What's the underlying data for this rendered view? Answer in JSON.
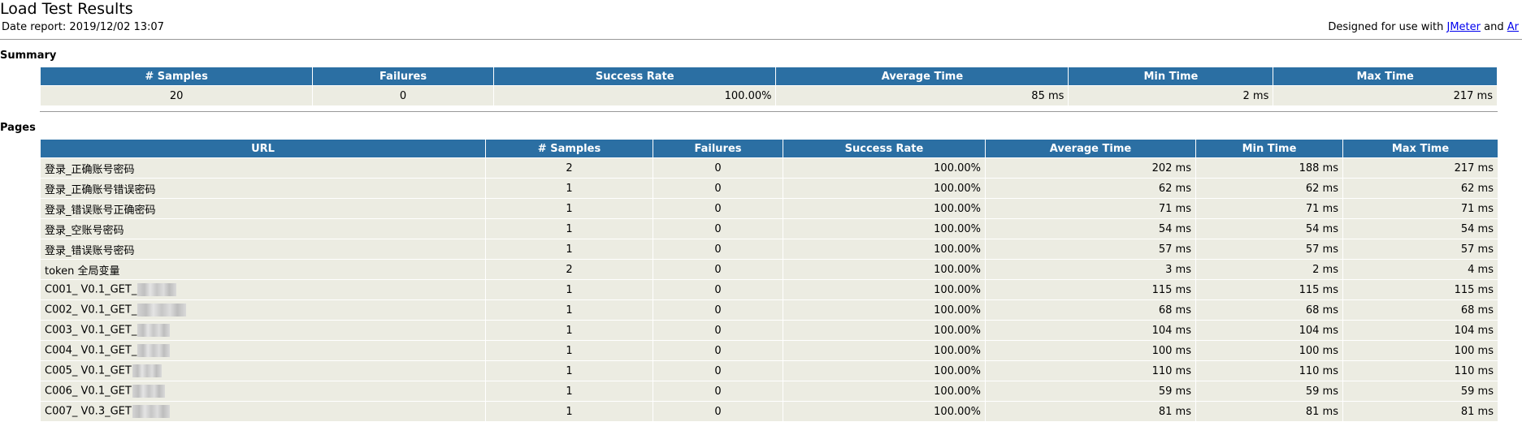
{
  "header": {
    "title": "Load Test Results",
    "date_label": "Date report: 2019/12/02 13:07",
    "designed_prefix": "Designed for use with",
    "designed_link1": "JMeter",
    "designed_and": "and",
    "designed_link2": "Ar"
  },
  "summary": {
    "heading": "Summary",
    "columns": [
      "# Samples",
      "Failures",
      "Success Rate",
      "Average Time",
      "Min Time",
      "Max Time"
    ],
    "row": [
      "20",
      "0",
      "100.00%",
      "85 ms",
      "2 ms",
      "217 ms"
    ]
  },
  "pages": {
    "heading": "Pages",
    "columns": [
      "URL",
      "# Samples",
      "Failures",
      "Success Rate",
      "Average Time",
      "Min Time",
      "Max Time"
    ],
    "rows": [
      [
        "登录_正确账号密码",
        "2",
        "0",
        "100.00%",
        "202 ms",
        "188 ms",
        "217 ms"
      ],
      [
        "登录_正确账号错误密码",
        "1",
        "0",
        "100.00%",
        "62 ms",
        "62 ms",
        "62 ms"
      ],
      [
        "登录_错误账号正确密码",
        "1",
        "0",
        "100.00%",
        "71 ms",
        "71 ms",
        "71 ms"
      ],
      [
        "登录_空账号密码",
        "1",
        "0",
        "100.00%",
        "54 ms",
        "54 ms",
        "54 ms"
      ],
      [
        "登录_错误账号密码",
        "1",
        "0",
        "100.00%",
        "57 ms",
        "57 ms",
        "57 ms"
      ],
      [
        "token 全局变量",
        "2",
        "0",
        "100.00%",
        "3 ms",
        "2 ms",
        "4 ms"
      ],
      [
        "C001_ V0.1_GET_",
        "1",
        "0",
        "100.00%",
        "115 ms",
        "115 ms",
        "115 ms"
      ],
      [
        "C002_ V0.1_GET_",
        "1",
        "0",
        "100.00%",
        "68 ms",
        "68 ms",
        "68 ms"
      ],
      [
        "C003_ V0.1_GET_",
        "1",
        "0",
        "100.00%",
        "104 ms",
        "104 ms",
        "104 ms"
      ],
      [
        "C004_ V0.1_GET_",
        "1",
        "0",
        "100.00%",
        "100 ms",
        "100 ms",
        "100 ms"
      ],
      [
        "C005_ V0.1_GET",
        "1",
        "0",
        "100.00%",
        "110 ms",
        "110 ms",
        "110 ms"
      ],
      [
        "C006_ V0.1_GET",
        "1",
        "0",
        "100.00%",
        "59 ms",
        "59 ms",
        "59 ms"
      ],
      [
        "C007_ V0.3_GET",
        "1",
        "0",
        "100.00%",
        "81 ms",
        "81 ms",
        "81 ms"
      ]
    ],
    "redacted_rows": [
      6,
      7,
      8,
      9,
      10,
      11,
      12
    ]
  }
}
